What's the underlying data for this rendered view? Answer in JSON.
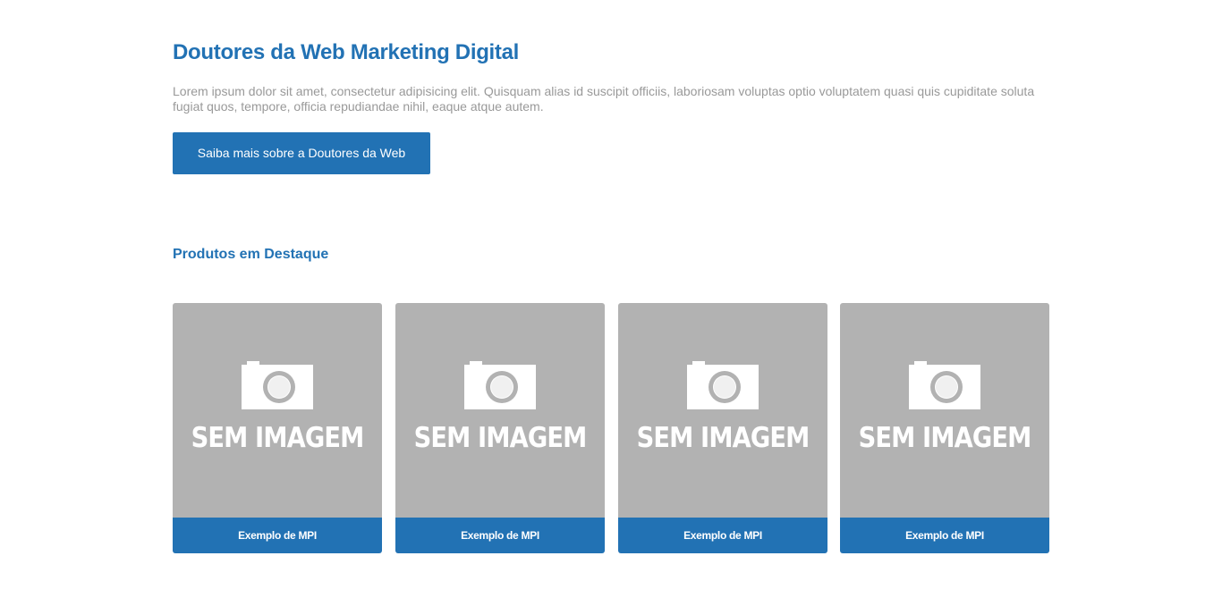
{
  "header": {
    "title": "Doutores da Web Marketing Digital",
    "intro": "Lorem ipsum dolor sit amet, consectetur adipisicing elit. Quisquam alias id suscipit officiis, laboriosam voluptas optio voluptatem quasi quis cupiditate soluta fugiat quos, tempore, officia repudiandae nihil, eaque atque autem.",
    "cta_label": "Saiba mais sobre a Doutores da Web"
  },
  "featured": {
    "title": "Produtos em Destaque",
    "products": [
      {
        "placeholder_text": "SEM IMAGEM",
        "icon": "camera-icon",
        "label": "Exemplo de MPI"
      },
      {
        "placeholder_text": "SEM IMAGEM",
        "icon": "camera-icon",
        "label": "Exemplo de MPI"
      },
      {
        "placeholder_text": "SEM IMAGEM",
        "icon": "camera-icon",
        "label": "Exemplo de MPI"
      },
      {
        "placeholder_text": "SEM IMAGEM",
        "icon": "camera-icon",
        "label": "Exemplo de MPI"
      }
    ]
  },
  "colors": {
    "accent": "#2272b4",
    "placeholder_bg": "#b2b2b2",
    "body_text": "#999999"
  }
}
